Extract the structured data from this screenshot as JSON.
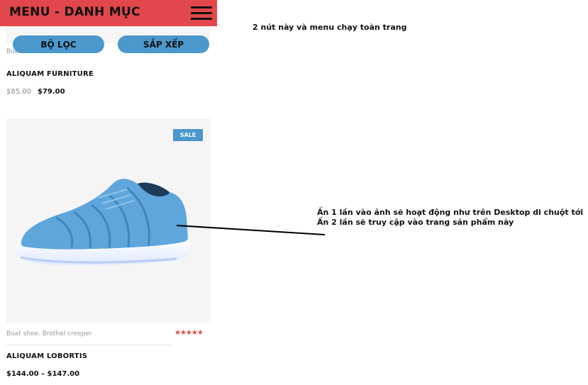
{
  "header": {
    "title": "MENU - DANH MỤC",
    "menu_icon": "hamburger-menu-icon",
    "background_color": "#e1474b"
  },
  "controls": {
    "filter_label": "BỘ LỌC",
    "sort_label": "SẮP XẾP",
    "button_color": "#4b98cc"
  },
  "products": [
    {
      "category": "Boat shoe. Chow Loot",
      "rating_stars": "★★★★★",
      "name": "ALIQUAM FURNITURE",
      "old_price": "$85.00",
      "price": "$79.00"
    },
    {
      "badge": "SALE",
      "image_icon": "blue-sneaker-image",
      "category": "Boat shoe. Brothel creeper",
      "rating_stars": "★★★★★",
      "name": "ALIQUAM LOBORTIS",
      "price": "$144.00 – $147.00"
    }
  ],
  "annotations": {
    "buttons_note": "2 nút này và menu chạy toàn trang",
    "image_note_line1": "Ấn 1 lần vào ảnh sẽ hoạt động như trên Desktop di chuột tới",
    "image_note_line2": "Ấn 2 lần sẽ truy cập vào trang sản phẩm này"
  },
  "colors": {
    "star": "#e04b3c",
    "badge": "#4b98cc",
    "shoe": "#5ea6dc"
  }
}
